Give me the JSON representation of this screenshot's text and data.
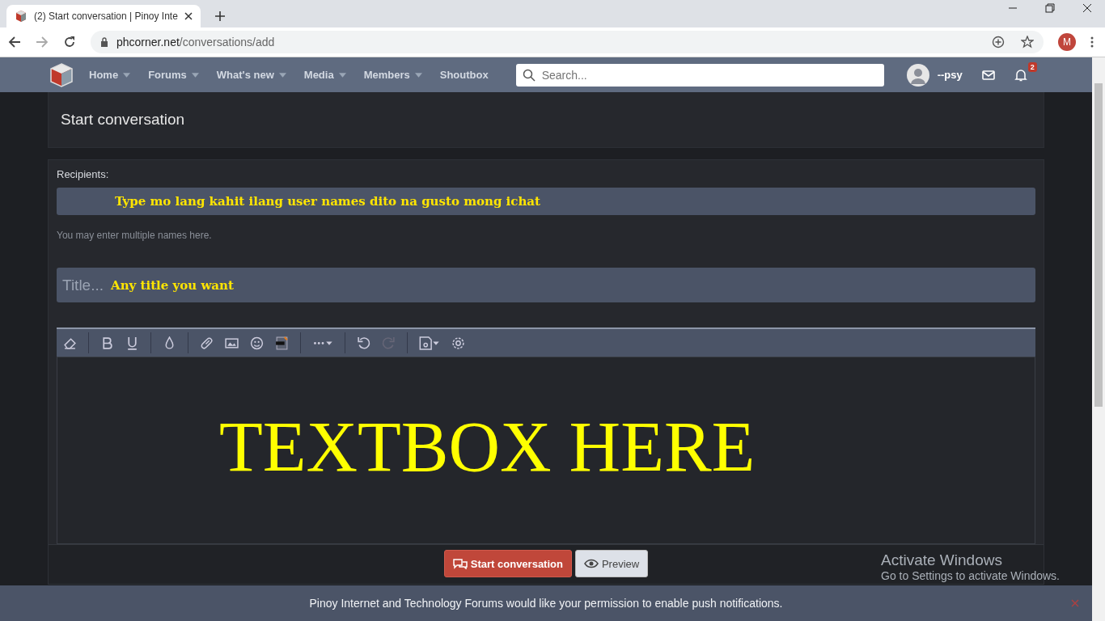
{
  "browser": {
    "tab_title": "(2) Start conversation | Pinoy Inte",
    "url_domain": "phcorner.net",
    "url_path": "/conversations/add",
    "profile_initial": "M"
  },
  "nav": {
    "items": [
      {
        "label": "Home",
        "dropdown": true
      },
      {
        "label": "Forums",
        "dropdown": true
      },
      {
        "label": "What's new",
        "dropdown": true
      },
      {
        "label": "Media",
        "dropdown": true
      },
      {
        "label": "Members",
        "dropdown": true
      },
      {
        "label": "Shoutbox",
        "dropdown": false
      }
    ],
    "search": {
      "placeholder": "Search..."
    },
    "username": "--psy",
    "alerts_badge": "2"
  },
  "page_title": "Start conversation",
  "form": {
    "recipients_label": "Recipients:",
    "recipients_note": "Type mo lang kahit ilang user names dito na gusto mong ichat",
    "recipients_hint": "You may enter multiple names here.",
    "title_placeholder": "Title...",
    "title_note": "Any title you want",
    "editor_note": "TEXTBOX HERE"
  },
  "buttons": {
    "submit": "Start conversation",
    "preview": "Preview"
  },
  "activation": {
    "title": "Activate Windows",
    "subtitle": "Go to Settings to activate Windows."
  },
  "push_notice": "Pinoy Internet and Technology Forums would like your permission to enable push notifications."
}
